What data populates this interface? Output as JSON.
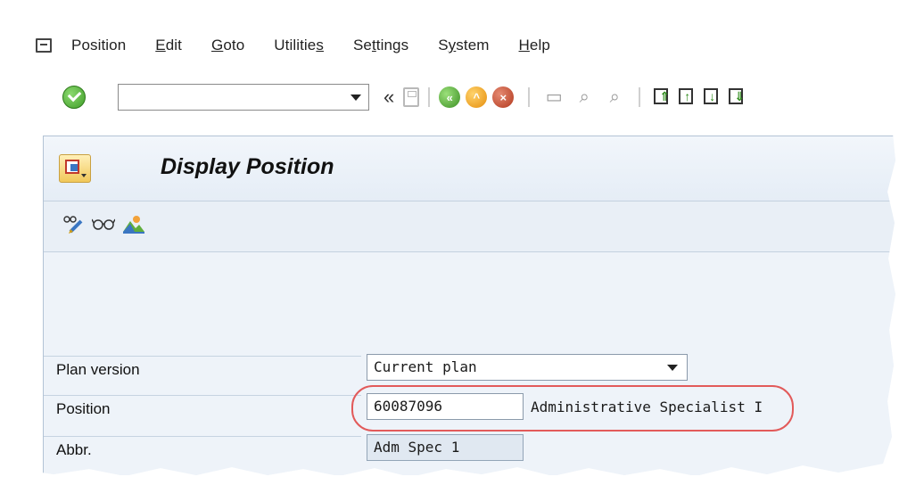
{
  "menubar": {
    "items": [
      {
        "label": "Position"
      },
      {
        "label_pre": "",
        "label_u": "E",
        "label_post": "dit"
      },
      {
        "label_pre": "",
        "label_u": "G",
        "label_post": "oto"
      },
      {
        "label_pre": "Utilitie",
        "label_u": "s",
        "label_post": ""
      },
      {
        "label_pre": "Se",
        "label_u": "t",
        "label_post": "tings"
      },
      {
        "label_pre": "S",
        "label_u": "y",
        "label_post": "stem"
      },
      {
        "label_pre": "",
        "label_u": "H",
        "label_post": "elp"
      }
    ]
  },
  "toolbar": {
    "command_value": "",
    "chevron": "«"
  },
  "screen": {
    "title": "Display Position"
  },
  "form": {
    "plan_version": {
      "label": "Plan version",
      "value": "Current plan"
    },
    "position": {
      "label": "Position",
      "value": "60087096",
      "description": "Administrative Specialist I"
    },
    "abbr": {
      "label": "Abbr.",
      "value": "Adm Spec 1"
    }
  },
  "colors": {
    "panel_bg": "#eef3f9",
    "highlight": "#e25a5a",
    "ok_green": "#3f9d28"
  }
}
